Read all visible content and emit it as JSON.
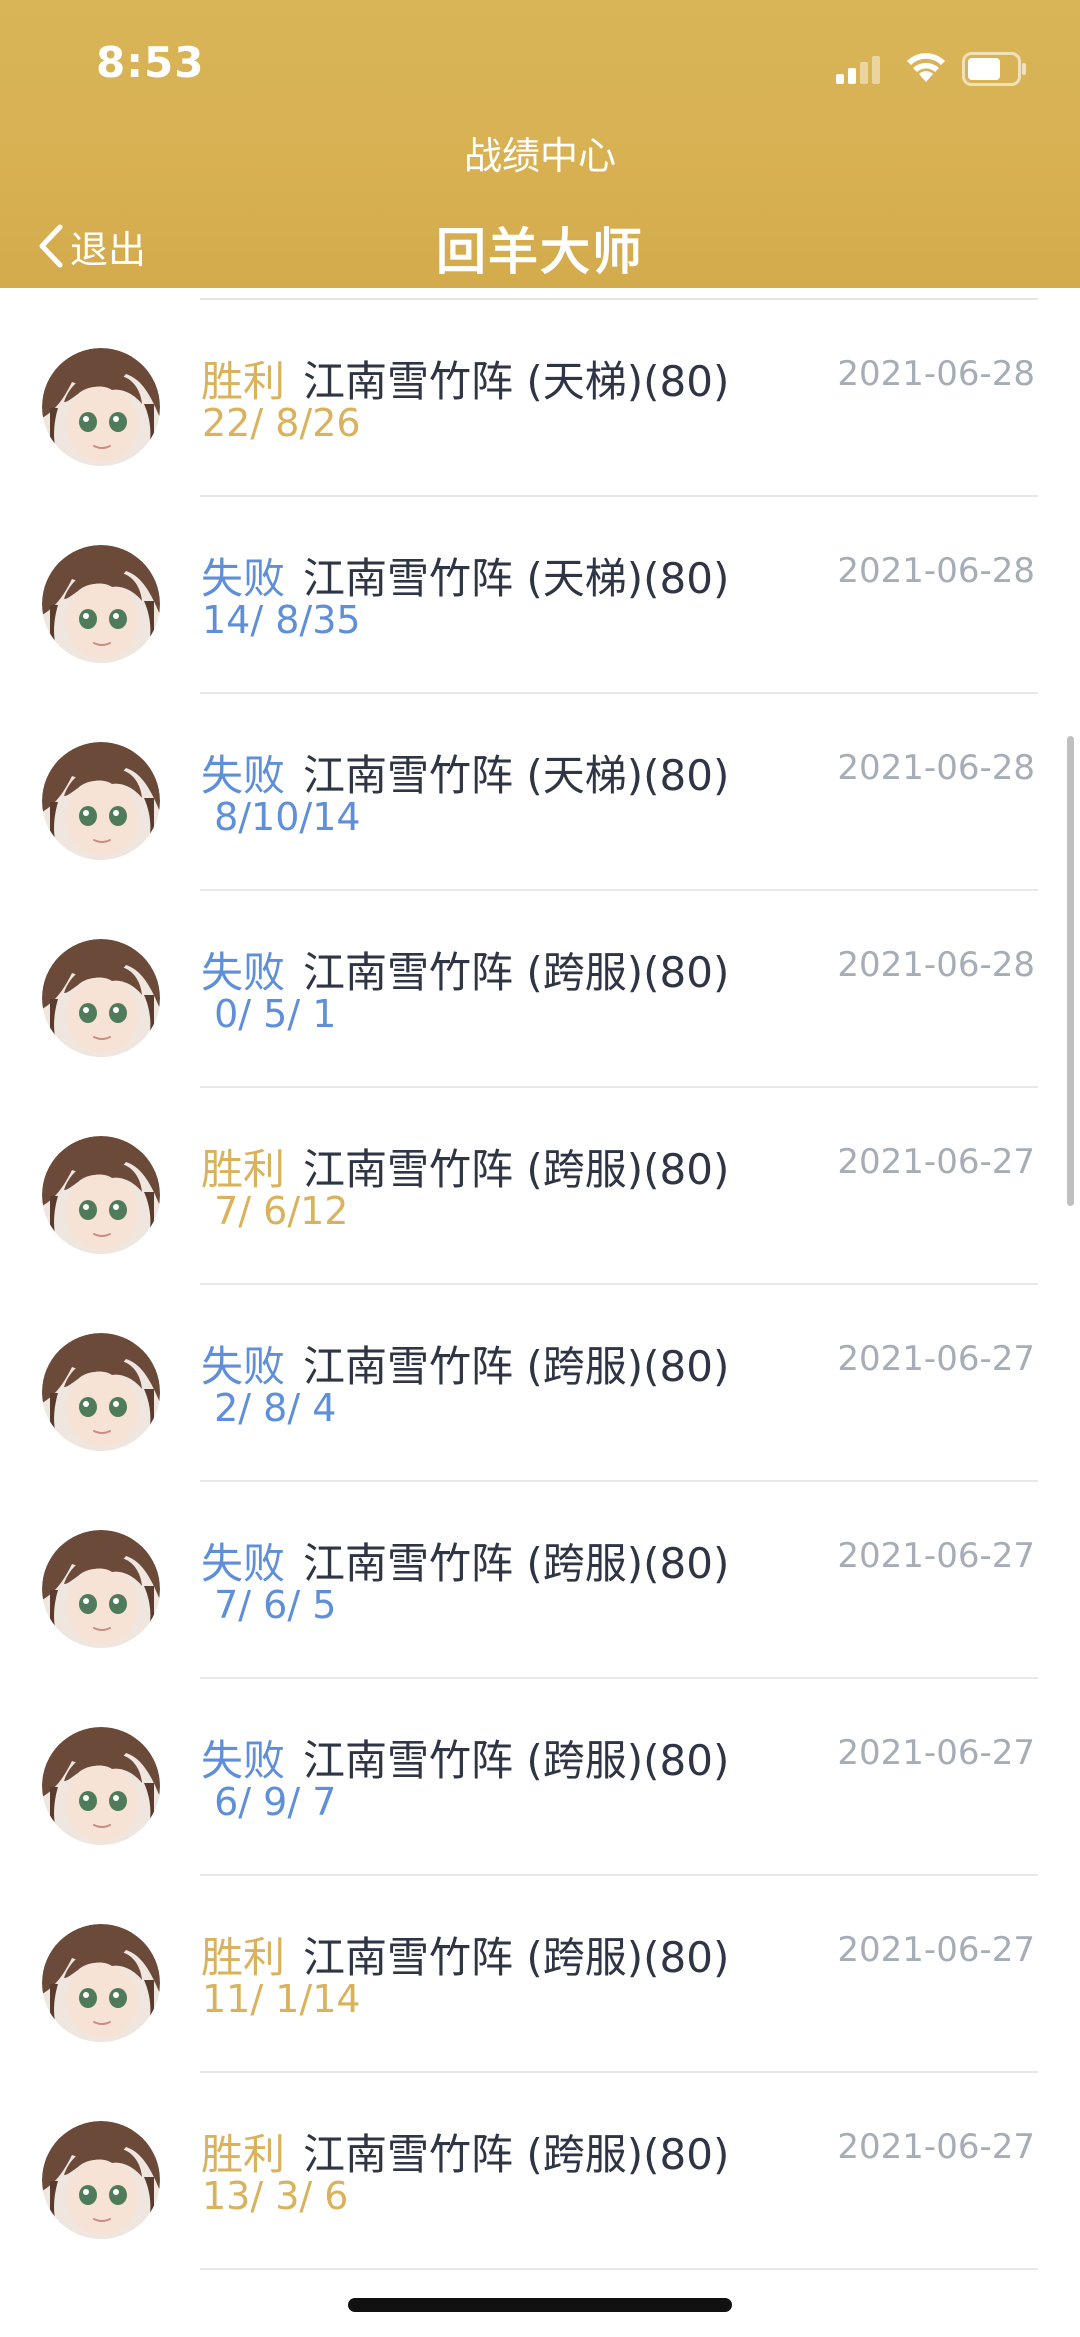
{
  "status_bar": {
    "time": "8:53"
  },
  "header": {
    "subtitle": "战绩中心",
    "back_label": "退出",
    "title": "回羊大师"
  },
  "records": [
    {
      "result": "胜利",
      "outcome": "win",
      "mode": "江南雪竹阵 (天梯)(80)",
      "kda": "22/ 8/26",
      "date": "2021-06-28"
    },
    {
      "result": "失败",
      "outcome": "lose",
      "mode": "江南雪竹阵 (天梯)(80)",
      "kda": "14/ 8/35",
      "date": "2021-06-28"
    },
    {
      "result": "失败",
      "outcome": "lose",
      "mode": "江南雪竹阵 (天梯)(80)",
      "kda": " 8/10/14",
      "date": "2021-06-28"
    },
    {
      "result": "失败",
      "outcome": "lose",
      "mode": "江南雪竹阵 (跨服)(80)",
      "kda": " 0/ 5/ 1",
      "date": "2021-06-28"
    },
    {
      "result": "胜利",
      "outcome": "win",
      "mode": "江南雪竹阵 (跨服)(80)",
      "kda": " 7/ 6/12",
      "date": "2021-06-27"
    },
    {
      "result": "失败",
      "outcome": "lose",
      "mode": "江南雪竹阵 (跨服)(80)",
      "kda": " 2/ 8/ 4",
      "date": "2021-06-27"
    },
    {
      "result": "失败",
      "outcome": "lose",
      "mode": "江南雪竹阵 (跨服)(80)",
      "kda": " 7/ 6/ 5",
      "date": "2021-06-27"
    },
    {
      "result": "失败",
      "outcome": "lose",
      "mode": "江南雪竹阵 (跨服)(80)",
      "kda": " 6/ 9/ 7",
      "date": "2021-06-27"
    },
    {
      "result": "胜利",
      "outcome": "win",
      "mode": "江南雪竹阵 (跨服)(80)",
      "kda": "11/ 1/14",
      "date": "2021-06-27"
    },
    {
      "result": "胜利",
      "outcome": "win",
      "mode": "江南雪竹阵 (跨服)(80)",
      "kda": "13/ 3/ 6",
      "date": "2021-06-27"
    }
  ],
  "colors": {
    "header_gold": "#d8b153",
    "win": "#d9b25b",
    "lose": "#5f8fd8",
    "date": "#a7adb7"
  }
}
